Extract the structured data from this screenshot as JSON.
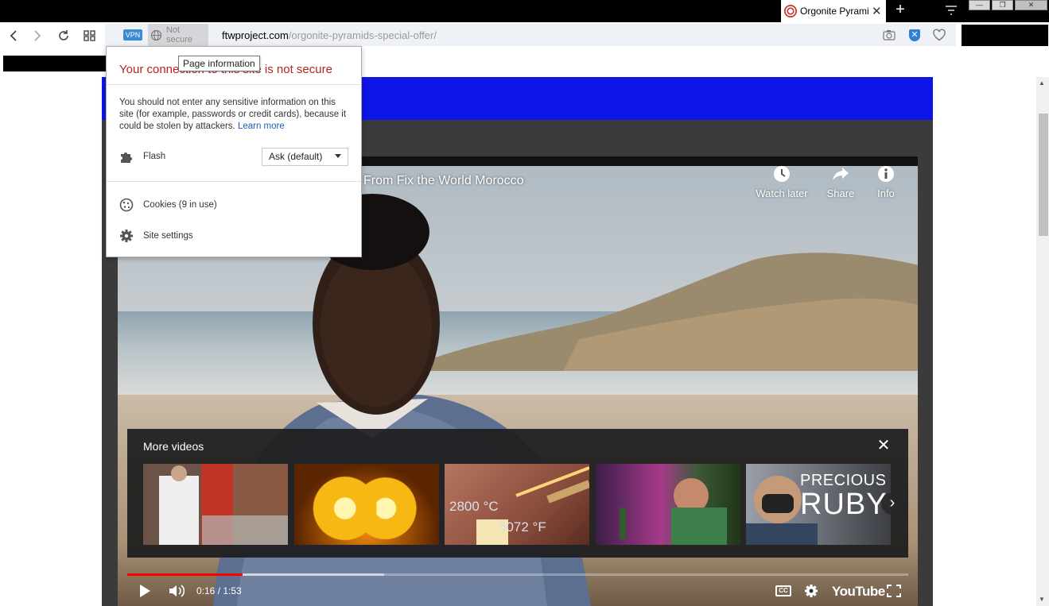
{
  "browser": {
    "tab": {
      "title": "Orgonite Pyramids",
      "close": "✕"
    },
    "new_tab": "+",
    "vpn_badge": "VPN",
    "security_label": "Not secure",
    "url": {
      "host": "ftwproject.com",
      "path": "/orgonite-pyramids-special-offer/"
    },
    "tooltip": "Page information"
  },
  "site_popup": {
    "title": "Your connection to this site is not secure",
    "description": "You should not enter any sensitive information on this site (for example, passwords or credit cards), because it could be stolen by attackers.",
    "learn_more": "Learn more",
    "flash_label": "Flash",
    "flash_value": "Ask (default)",
    "cookies_label": "Cookies (9 in use)",
    "site_settings_label": "Site settings"
  },
  "video": {
    "title": "From Fix the World Morocco",
    "tools": [
      {
        "label": "Watch later",
        "icon": "clock-icon"
      },
      {
        "label": "Share",
        "icon": "share-arrow-icon"
      },
      {
        "label": "Info",
        "icon": "info-icon"
      }
    ],
    "more_videos": {
      "heading": "More videos",
      "thumbs": [
        {
          "overlay": ""
        },
        {
          "overlay": ""
        },
        {
          "overlay_1": "2800 °C",
          "overlay_2": "5072 °F"
        },
        {
          "overlay": ""
        },
        {
          "overlay_1": "PRECIOUS",
          "overlay_2": "RUBY"
        }
      ]
    },
    "progress": {
      "played_fraction": 0.148,
      "buffered_fraction": 0.329
    },
    "time": "0:16 / 1:53",
    "cc": "CC",
    "logo": "YouTube"
  }
}
